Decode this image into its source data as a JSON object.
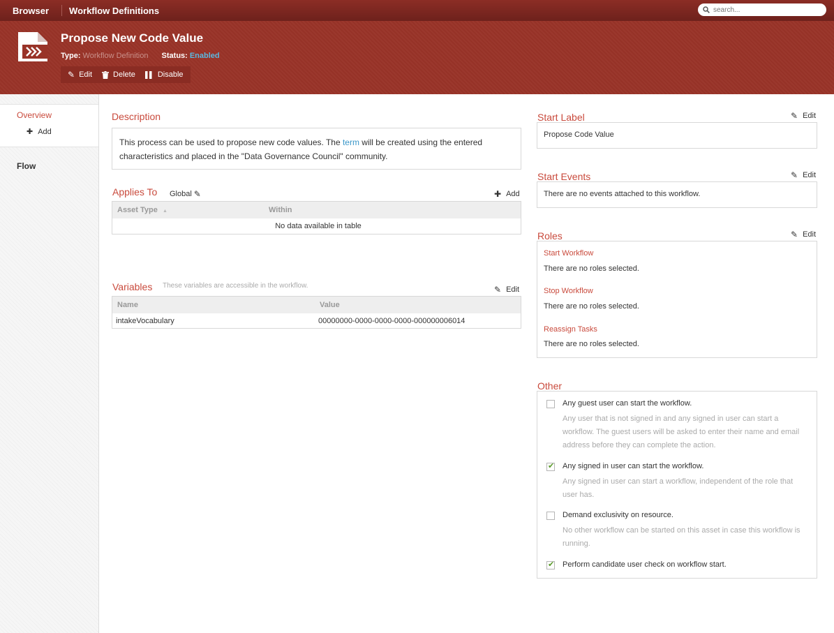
{
  "topbar": {
    "brand": "Browser",
    "section": "Workflow Definitions",
    "search_placeholder": "search..."
  },
  "header": {
    "title": "Propose New Code Value",
    "type_label": "Type:",
    "type_value": "Workflow Definition",
    "status_label": "Status:",
    "status_value": "Enabled",
    "actions": {
      "edit": "Edit",
      "delete": "Delete",
      "disable": "Disable"
    }
  },
  "sidebar": {
    "overview": "Overview",
    "add": "Add",
    "flow": "Flow"
  },
  "description": {
    "title": "Description",
    "text_before": "This process can be used to propose new code values. The ",
    "link": "term",
    "text_after": " will be created using the entered characteristics and placed in the \"Data Governance Council\" community."
  },
  "applies_to": {
    "title": "Applies To",
    "scope": "Global",
    "add": "Add",
    "columns": [
      "Asset Type",
      "Within"
    ],
    "empty": "No data available in table"
  },
  "variables": {
    "title": "Variables",
    "hint": "These variables are accessible in the workflow.",
    "edit": "Edit",
    "columns": [
      "Name",
      "Value"
    ],
    "rows": [
      {
        "name": "intakeVocabulary",
        "value": "00000000-0000-0000-0000-000000006014"
      }
    ]
  },
  "start_label": {
    "title": "Start Label",
    "edit": "Edit",
    "value": "Propose Code Value"
  },
  "start_events": {
    "title": "Start Events",
    "edit": "Edit",
    "value": "There are no events attached to this workflow."
  },
  "roles": {
    "title": "Roles",
    "edit": "Edit",
    "items": [
      {
        "label": "Start Workflow",
        "text": "There are no roles selected."
      },
      {
        "label": "Stop Workflow",
        "text": "There are no roles selected."
      },
      {
        "label": "Reassign Tasks",
        "text": "There are no roles selected."
      }
    ]
  },
  "other": {
    "title": "Other",
    "options": [
      {
        "label": "Any guest user can start the workflow.",
        "checked": false,
        "desc": "Any user that is not signed in and any signed in user can start a workflow. The guest users will be asked to enter their name and email address before they can complete the action."
      },
      {
        "label": "Any signed in user can start the workflow.",
        "checked": true,
        "desc": "Any signed in user can start a workflow, independent of the role that user has."
      },
      {
        "label": "Demand exclusivity on resource.",
        "checked": false,
        "desc": "No other workflow can be started on this asset in case this workflow is running."
      },
      {
        "label": "Perform candidate user check on workflow start.",
        "checked": true,
        "desc": ""
      }
    ]
  }
}
